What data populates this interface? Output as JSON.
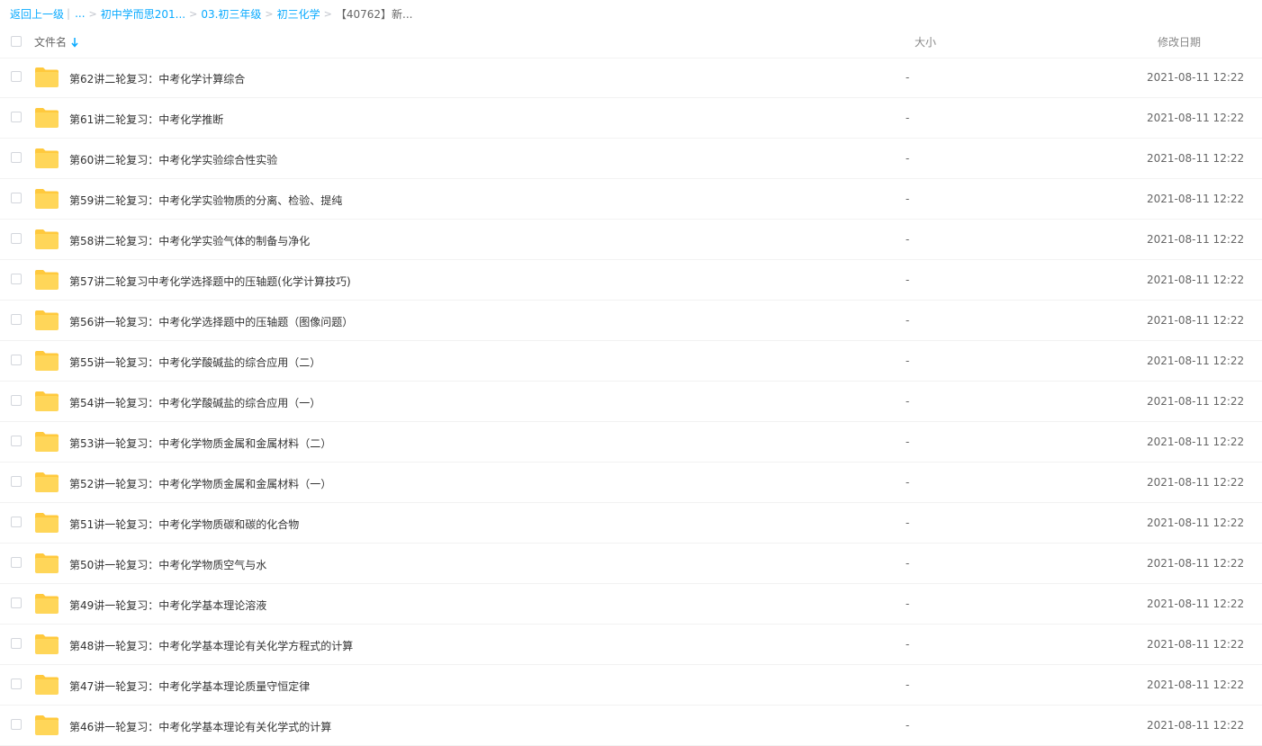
{
  "breadcrumb": {
    "back": "返回上一级",
    "bar": "|",
    "ellipsis": "...",
    "items": [
      "初中学而思201...",
      "03.初三年级",
      "初三化学"
    ],
    "current": "【40762】新..."
  },
  "header": {
    "name_label": "文件名",
    "size_label": "大小",
    "date_label": "修改日期",
    "sort_icon": "arrow-down-icon"
  },
  "files": [
    {
      "name": "第62讲二轮复习：中考化学计算综合",
      "size": "-",
      "date": "2021-08-11 12:22"
    },
    {
      "name": "第61讲二轮复习：中考化学推断",
      "size": "-",
      "date": "2021-08-11 12:22"
    },
    {
      "name": "第60讲二轮复习：中考化学实验综合性实验",
      "size": "-",
      "date": "2021-08-11 12:22"
    },
    {
      "name": "第59讲二轮复习：中考化学实验物质的分离、检验、提纯",
      "size": "-",
      "date": "2021-08-11 12:22"
    },
    {
      "name": "第58讲二轮复习：中考化学实验气体的制备与净化",
      "size": "-",
      "date": "2021-08-11 12:22"
    },
    {
      "name": "第57讲二轮复习中考化学选择题中的压轴题(化学计算技巧)",
      "size": "-",
      "date": "2021-08-11 12:22"
    },
    {
      "name": "第56讲一轮复习：中考化学选择题中的压轴题（图像问题）",
      "size": "-",
      "date": "2021-08-11 12:22"
    },
    {
      "name": "第55讲一轮复习：中考化学酸碱盐的综合应用（二）",
      "size": "-",
      "date": "2021-08-11 12:22"
    },
    {
      "name": "第54讲一轮复习：中考化学酸碱盐的综合应用（一）",
      "size": "-",
      "date": "2021-08-11 12:22"
    },
    {
      "name": "第53讲一轮复习：中考化学物质金属和金属材料（二）",
      "size": "-",
      "date": "2021-08-11 12:22"
    },
    {
      "name": "第52讲一轮复习：中考化学物质金属和金属材料（一）",
      "size": "-",
      "date": "2021-08-11 12:22"
    },
    {
      "name": "第51讲一轮复习：中考化学物质碳和碳的化合物",
      "size": "-",
      "date": "2021-08-11 12:22"
    },
    {
      "name": "第50讲一轮复习：中考化学物质空气与水",
      "size": "-",
      "date": "2021-08-11 12:22"
    },
    {
      "name": "第49讲一轮复习：中考化学基本理论溶液",
      "size": "-",
      "date": "2021-08-11 12:22"
    },
    {
      "name": "第48讲一轮复习：中考化学基本理论有关化学方程式的计算",
      "size": "-",
      "date": "2021-08-11 12:22"
    },
    {
      "name": "第47讲一轮复习：中考化学基本理论质量守恒定律",
      "size": "-",
      "date": "2021-08-11 12:22"
    },
    {
      "name": "第46讲一轮复习：中考化学基本理论有关化学式的计算",
      "size": "-",
      "date": "2021-08-11 12:22"
    }
  ],
  "colors": {
    "link": "#09aaff",
    "folder": "#ffd659",
    "folder_tab": "#ffc93d"
  },
  "icons": {
    "row_icon": "folder-icon"
  }
}
